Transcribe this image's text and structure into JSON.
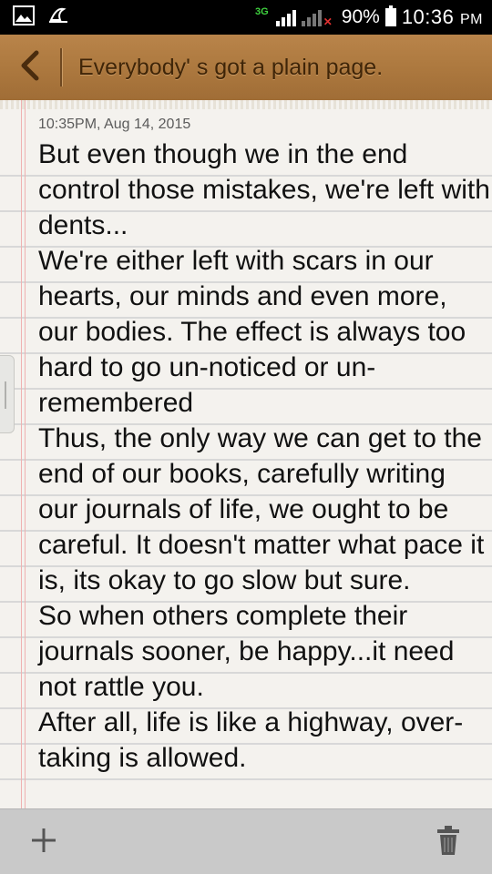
{
  "status_bar": {
    "network": "3G",
    "battery": "90%",
    "time": "10:36",
    "ampm": "PM",
    "icons": [
      "gallery-icon",
      "night-mode-icon",
      "signal-icon",
      "battery-icon"
    ]
  },
  "header": {
    "title": "Everybody' s got a plain page.",
    "back_icon": "chevron-left-icon"
  },
  "note": {
    "date": "10:35PM, Aug 14, 2015",
    "body": "But even though we in the end control those mistakes, we're left with dents...\nWe're either left with scars in our hearts, our minds and even more, our bodies. The effect is always too hard to go un-noticed or un-remembered\nThus, the only way we can get to the end of our books, carefully writing our journals of life, we ought to be careful. It doesn't matter what pace it is, its okay to go slow but sure.\nSo when others complete their journals sooner, be happy...it need not rattle you.\nAfter all, life is like a highway, over-taking is allowed."
  },
  "bottom_bar": {
    "add_icon": "plus-icon",
    "delete_icon": "trash-icon"
  },
  "colors": {
    "header_wood": "#ae7a40",
    "paper": "#f4f2ee",
    "margin_line": "#efb2b2",
    "bottom_bar": "#c9c9c9"
  }
}
